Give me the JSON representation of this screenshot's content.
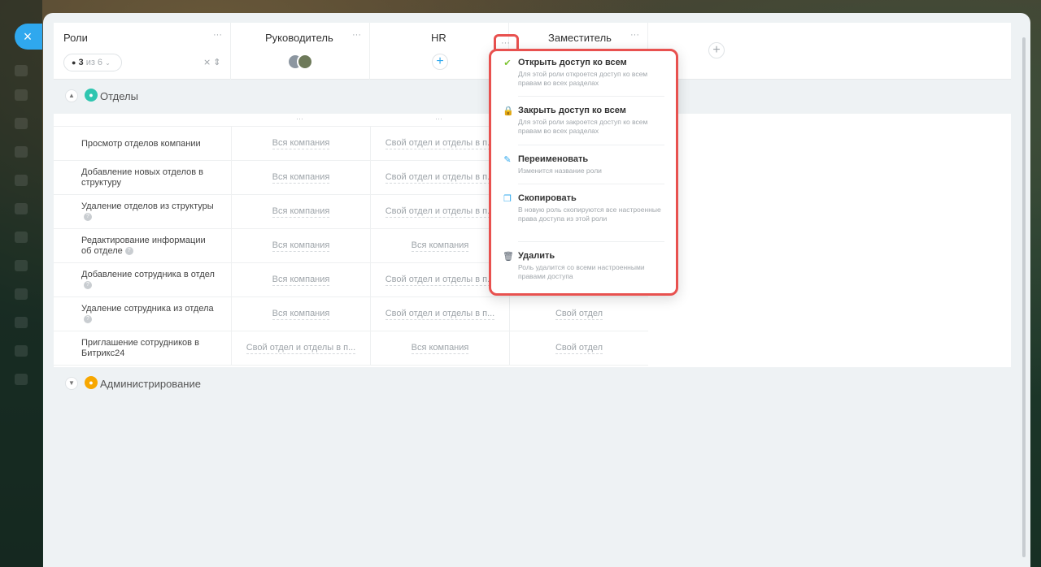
{
  "close_button": {
    "label": "×"
  },
  "header": {
    "roles_title": "Роли",
    "filter": {
      "count": "3",
      "suffix": "из 6"
    },
    "dots": "···",
    "columns": [
      "Руководитель",
      "HR",
      "Заместитель"
    ],
    "plus": "+"
  },
  "sections": [
    {
      "label": "Отделы",
      "color": "#2fc6b0"
    },
    {
      "label": "Администрирование",
      "color": "#f7a700"
    }
  ],
  "subheader_dots": "···",
  "rows": [
    {
      "name": "Просмотр отделов компании",
      "hint": false,
      "cells": [
        "Вся компания",
        "Свой отдел и отделы в п...",
        ""
      ]
    },
    {
      "name": "Добавление новых отделов в структуру",
      "hint": false,
      "cells": [
        "Вся компания",
        "Свой отдел и отделы в п...",
        ""
      ]
    },
    {
      "name": "Удаление отделов из структуры",
      "hint": true,
      "cells": [
        "Вся компания",
        "Свой отдел и отделы в п...",
        ""
      ]
    },
    {
      "name": "Редактирование информации об отделе",
      "hint": true,
      "cells": [
        "Вся компания",
        "Вся компания",
        ""
      ]
    },
    {
      "name": "Добавление сотрудника в отдел",
      "hint": true,
      "cells": [
        "Вся компания",
        "Свой отдел и отделы в п...",
        ""
      ]
    },
    {
      "name": "Удаление сотрудника из отдела",
      "hint": true,
      "cells": [
        "Вся компания",
        "Свой отдел и отделы в п...",
        "Свой отдел"
      ]
    },
    {
      "name": "Приглашение сотрудников в Битрикс24",
      "hint": false,
      "cells": [
        "Свой отдел и отделы в п...",
        "Вся компания",
        "Свой отдел"
      ]
    }
  ],
  "menu": {
    "items": [
      {
        "icon": "✔",
        "color": "#7bc32e",
        "title": "Открыть доступ ко всем",
        "desc": "Для этой роли откроется доступ ко всем правам во всех разделах"
      },
      {
        "icon": "🔒",
        "color": "#e8514f",
        "title": "Закрыть доступ ко всем",
        "desc": "Для этой роли закроется доступ ко всем правам во всех разделах"
      },
      {
        "icon": "✎",
        "color": "#2fa8ee",
        "title": "Переименовать",
        "desc": "Изменится название роли"
      },
      {
        "icon": "❐",
        "color": "#2fa8ee",
        "title": "Скопировать",
        "desc": "В новую роль скопируются все настроенные права доступа из этой роли"
      },
      {
        "icon": "🗑",
        "color": "#525c69",
        "title": "Удалить",
        "desc": "Роль удалится со всеми настроенными правами доступа"
      }
    ]
  }
}
